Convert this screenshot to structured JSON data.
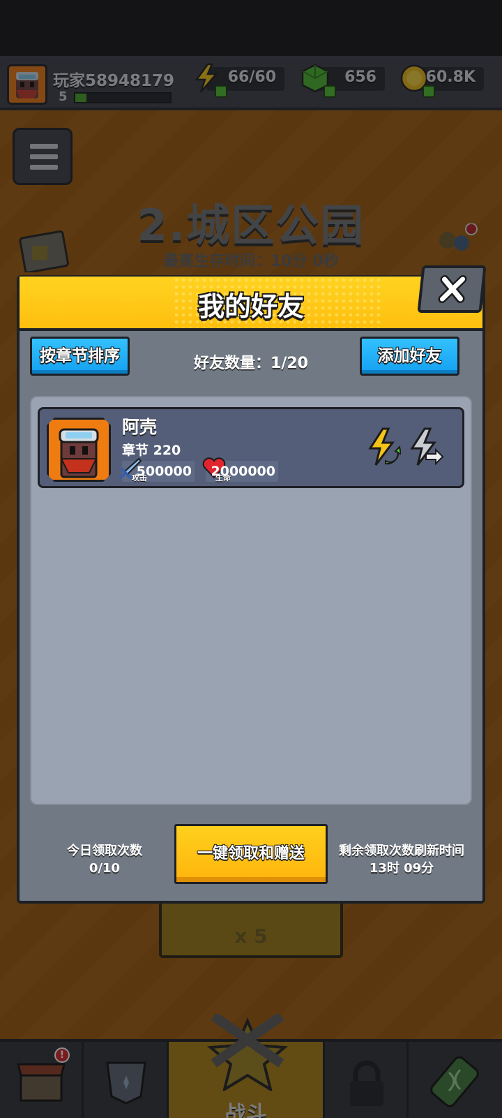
{
  "player": {
    "name": "玩家58948179",
    "level": "5",
    "xp_fraction": 0.12
  },
  "resources": {
    "energy": {
      "value": "66/60",
      "icon": "lightning-icon"
    },
    "gems": {
      "value": "656",
      "icon": "green-gem-icon"
    },
    "coins": {
      "value": "60.8K",
      "icon": "gold-coin-icon"
    }
  },
  "stage": {
    "title": "2.城区公园",
    "best_time": "最高生存时间：10分 0秒"
  },
  "start": {
    "cost": "x 5"
  },
  "nav": {
    "battle_label": "战斗",
    "badge": "!"
  },
  "modal": {
    "title": "我的好友",
    "sort_button": "按章节排序",
    "friend_count": "好友数量：1/20",
    "add_button": "添加好友",
    "friends": [
      {
        "name": "阿壳",
        "chapter": "章节 220",
        "attack": "500000",
        "attack_tag": "攻击",
        "hp": "2000000",
        "hp_tag": "生命"
      }
    ],
    "daily_label": "今日领取次数",
    "daily_value": "0/10",
    "claim_button": "一键领取和赠送",
    "refresh_label": "剩余领取次数刷新时间",
    "refresh_value": "13时 09分"
  },
  "colors": {
    "header_yellow": "#ffbf0f",
    "button_blue": "#14a0f0",
    "card_bg": "#545e78",
    "panel_bg": "#9aa3b1"
  }
}
